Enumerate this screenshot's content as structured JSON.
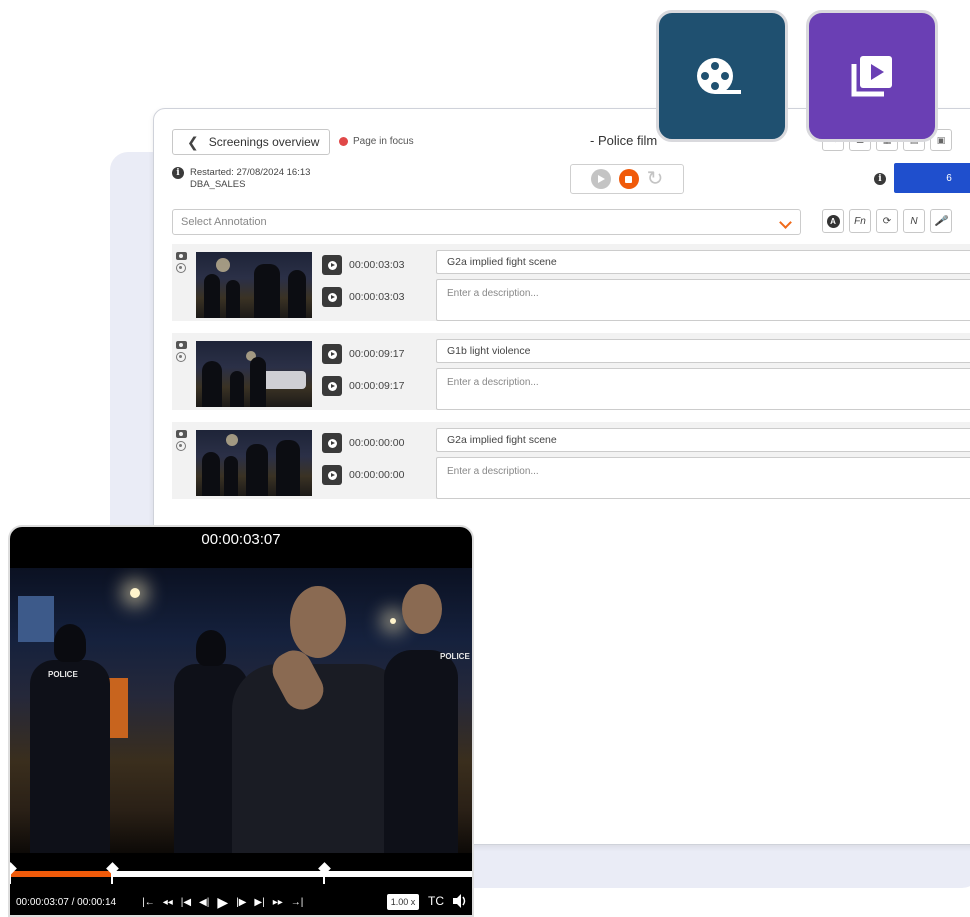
{
  "header": {
    "back_label": "Screenings overview",
    "focus_label": "Page in focus",
    "title": "- Police film",
    "restart_line1": "Restarted: 27/08/2024 16:13",
    "restart_line2": "DBA_SALES",
    "blue_button_label": "6"
  },
  "annotation_select": {
    "placeholder": "Select Annotation"
  },
  "tools": {
    "fn_label": "Fn",
    "n_label": "N",
    "a_label": "A"
  },
  "annotations": [
    {
      "tc_in": "00:00:03:03",
      "tc_out": "00:00:03:03",
      "category": "G2a implied fight scene",
      "description_placeholder": "Enter a description..."
    },
    {
      "tc_in": "00:00:09:17",
      "tc_out": "00:00:09:17",
      "category": "G1b light violence",
      "description_placeholder": "Enter a description..."
    },
    {
      "tc_in": "00:00:00:00",
      "tc_out": "00:00:00:00",
      "category": "G2a implied fight scene",
      "description_placeholder": "Enter a description..."
    }
  ],
  "player": {
    "timecode_top": "00:00:03:07",
    "position": "00:00:03:07 / 00:00:14",
    "speed": "1.00 x",
    "tc_label": "TC",
    "progress": 0.22,
    "markers": [
      0.0,
      0.22,
      0.68
    ],
    "police_label": "POLICE"
  },
  "colors": {
    "accent_orange": "#f05a0a",
    "blue_button": "#1f4fcd",
    "film_tile": "#1f5070",
    "video_tile": "#6a3fb4"
  },
  "icons": [
    "back-chevron-icon",
    "film-reel-icon",
    "video-library-icon",
    "play-icon",
    "stop-icon",
    "redo-icon",
    "info-icon",
    "camera-icon",
    "target-icon",
    "volume-icon"
  ]
}
